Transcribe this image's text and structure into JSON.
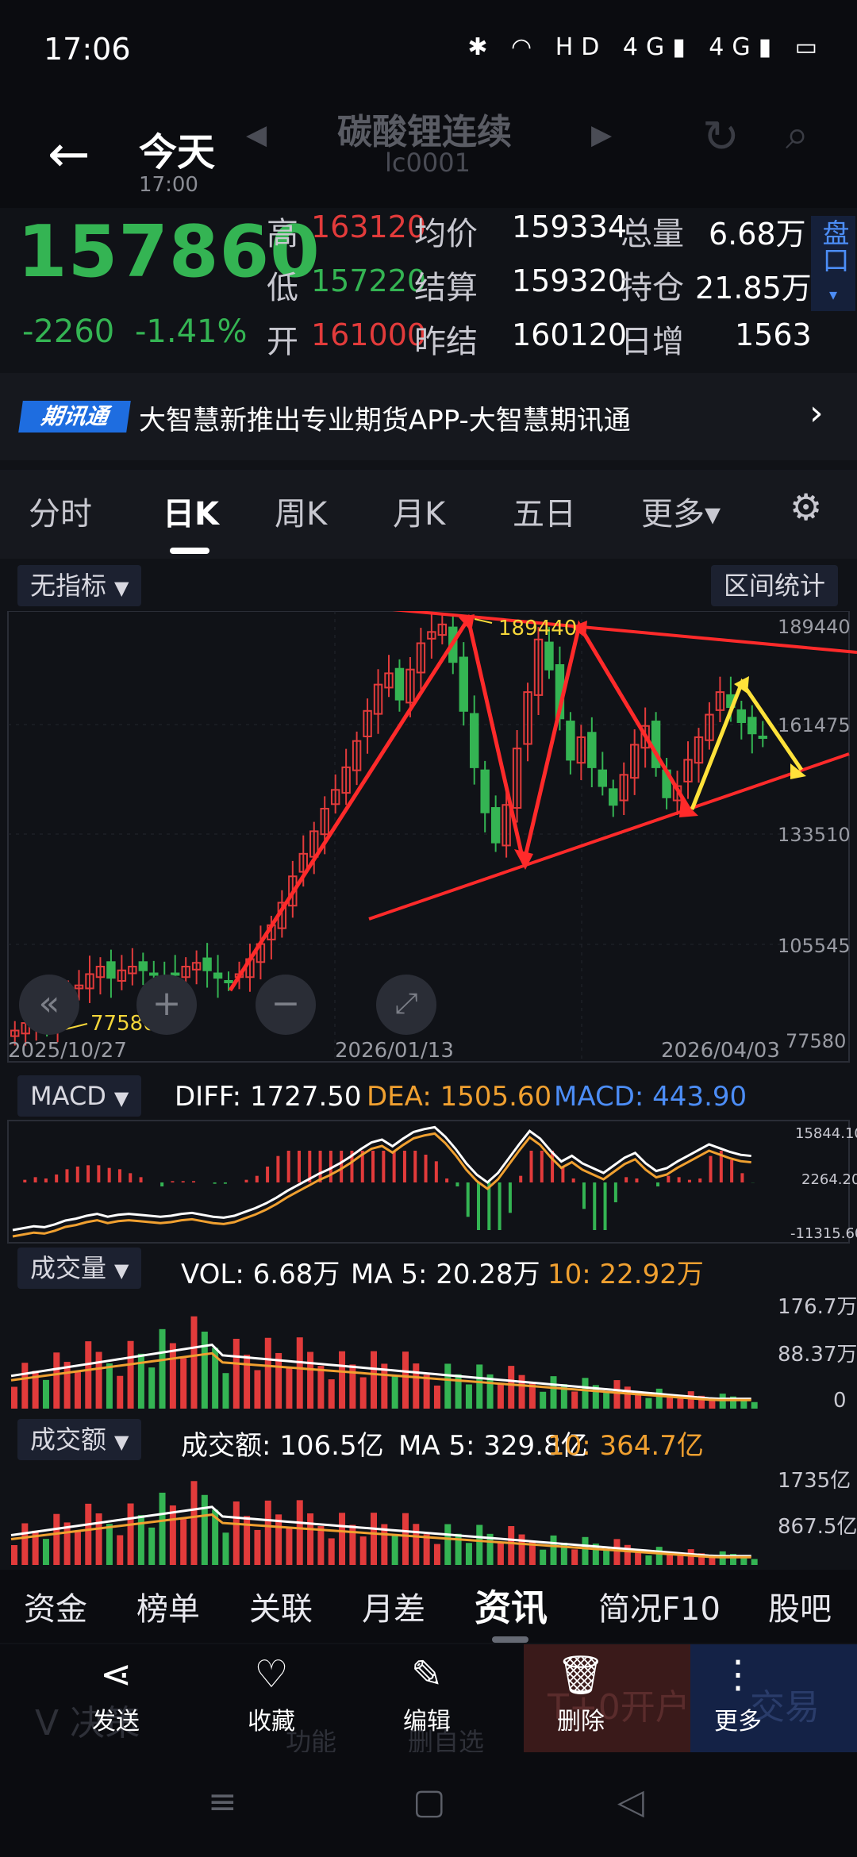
{
  "status": {
    "time": "17:06",
    "icons": "✱ ◠ HD 4G▮ 4G▮ ▭"
  },
  "header": {
    "back": "←",
    "today": "今天",
    "today_time": "17:00",
    "title": "碳酸锂连续",
    "code": "lc0001",
    "nav_left": "◀",
    "nav_right": "▶"
  },
  "quote": {
    "price": "157860",
    "change": "-2260",
    "change_pct": "-1.41%",
    "row1": {
      "l1": "高",
      "v1": "163120",
      "l2": "均价",
      "v2": "159334",
      "l3": "总量",
      "v3": "6.68万"
    },
    "row2": {
      "l1": "低",
      "v1": "157220",
      "l2": "结算",
      "v2": "159320",
      "l3": "持仓",
      "v3": "21.85万"
    },
    "row3": {
      "l1": "开",
      "v1": "161000",
      "l2": "昨结",
      "v2": "160120",
      "l3": "日增",
      "v3": "1563"
    },
    "pankou": "盘口"
  },
  "banner": {
    "logo": "期讯通",
    "text": "大智慧新推出专业期货APP-大智慧期讯通",
    "arrow": "›"
  },
  "tabs": [
    "分时",
    "日K",
    "周K",
    "月K",
    "五日",
    "更多▾"
  ],
  "kline": {
    "indicator": "无指标",
    "range_stats": "区间统计",
    "y_labels": [
      "189440",
      "161475",
      "133510",
      "105545",
      "77580"
    ],
    "dates": [
      "2025/10/27",
      "2026/01/13",
      "2026/04/03"
    ],
    "high_label": "189440",
    "low_label": "77580"
  },
  "macd": {
    "name": "MACD",
    "diff": "DIFF: 1727.50",
    "dea": "DEA: 1505.60",
    "macd": "MACD: 443.90",
    "y_labels": [
      "15844.10",
      "2264.20",
      "-11315.60"
    ]
  },
  "vol": {
    "name": "成交量",
    "vol": "VOL: 6.68万",
    "ma5": "MA 5: 20.28万",
    "ma10": "10: 22.92万",
    "y_labels": [
      "176.7万",
      "88.37万",
      "0"
    ]
  },
  "amt": {
    "name": "成交额",
    "amt": "成交额: 106.5亿",
    "ma5": "MA 5: 329.8亿",
    "ma10": "10: 364.7亿",
    "y_labels": [
      "1735亿",
      "867.5亿"
    ]
  },
  "bottom_tabs": [
    "资金",
    "榜单",
    "关联",
    "月差",
    "资讯",
    "简况F10",
    "股吧"
  ],
  "actions": [
    {
      "icon": "⋖",
      "label": "发送"
    },
    {
      "icon": "♡",
      "label": "收藏"
    },
    {
      "icon": "✎",
      "label": "编辑"
    },
    {
      "icon": "🗑",
      "label": "删除"
    },
    {
      "icon": "⋮",
      "label": "更多"
    }
  ],
  "ghost": {
    "decision": "V 决策",
    "func": "功能",
    "delself": "删自选",
    "open": "T+0开户",
    "trade": "交易"
  },
  "colors": {
    "up": "#e23b3b",
    "down": "#34b453",
    "accent": "#4c8df6",
    "dea": "#f0a030",
    "annot": "#ff2a2a",
    "arrow": "#ffe23a"
  },
  "chart_data": {
    "type": "candlestick",
    "title": "碳酸锂连续",
    "x_ticks": [
      "2025/10/27",
      "2026/01/13",
      "2026/04/03"
    ],
    "ylim": [
      77580,
      189440
    ],
    "y_ticks": [
      189440,
      161475,
      133510,
      105545,
      77580
    ],
    "closes": [
      80000,
      82000,
      84000,
      83000,
      86000,
      90000,
      92000,
      95000,
      97000,
      94000,
      96000,
      97000,
      96000,
      95000,
      94000,
      95000,
      97000,
      98000,
      96000,
      94000,
      93000,
      95000,
      99000,
      103000,
      108000,
      114000,
      121000,
      127000,
      133000,
      139000,
      144000,
      150000,
      157000,
      165000,
      172000,
      175000,
      168000,
      176000,
      183000,
      186000,
      188000,
      178000,
      165000,
      150000,
      138000,
      130000,
      140000,
      155000,
      170000,
      184000,
      176000,
      163000,
      152000,
      158000,
      150000,
      145000,
      140000,
      148000,
      156000,
      161000,
      150000,
      142000,
      145000,
      152000,
      158000,
      164000,
      170000,
      166000,
      162000,
      159000,
      157860
    ],
    "annotation_high": 189440,
    "annotation_low": 77580
  }
}
